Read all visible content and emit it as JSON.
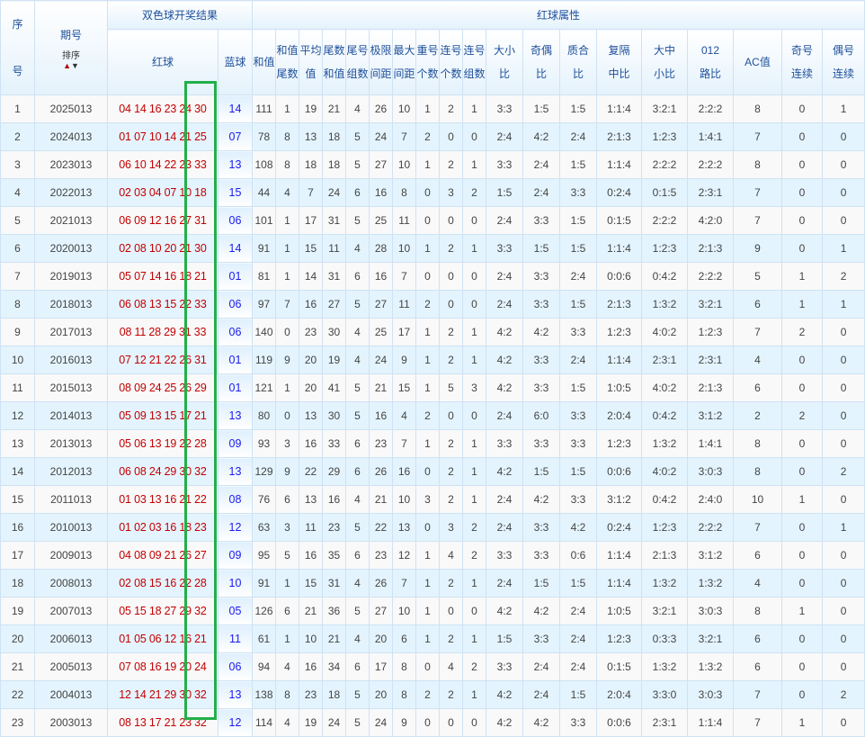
{
  "header": {
    "seq": "序号",
    "period": "期号",
    "sort_label": "排序",
    "sort_up": "▲",
    "sort_down": "▼",
    "result_group": "双色球开奖结果",
    "red_ball": "红球",
    "blue_ball": "蓝球",
    "attr_group": "红球属性",
    "attr_cols": [
      [
        "和值"
      ],
      [
        "和值",
        "尾数"
      ],
      [
        "平均",
        "值"
      ],
      [
        "尾数",
        "和值"
      ],
      [
        "尾号",
        "组数"
      ],
      [
        "极限",
        "间距"
      ],
      [
        "最大",
        "间距"
      ],
      [
        "重号",
        "个数"
      ],
      [
        "连号",
        "个数"
      ],
      [
        "连号",
        "组数"
      ],
      [
        "大小",
        "比"
      ],
      [
        "奇偶",
        "比"
      ],
      [
        "质合",
        "比"
      ],
      [
        "复隔",
        "中比"
      ],
      [
        "大中",
        "小比"
      ],
      [
        "012",
        "路比"
      ],
      [
        "AC值"
      ],
      [
        "奇号",
        "连续"
      ],
      [
        "偶号",
        "连续"
      ]
    ]
  },
  "colors": {
    "red_ball": "#c40000",
    "blue_ball": "#1a1aee",
    "highlight_box": "#22b04a",
    "header_text": "#1e4f9a"
  },
  "rows": [
    {
      "seq": "1",
      "period": "2025013",
      "red": "04 14 16 23 24 30",
      "blue": "14",
      "attrs": [
        "111",
        "1",
        "19",
        "21",
        "4",
        "26",
        "10",
        "1",
        "2",
        "1",
        "3:3",
        "1:5",
        "1:5",
        "1:1:4",
        "3:2:1",
        "2:2:2",
        "8",
        "0",
        "1"
      ]
    },
    {
      "seq": "2",
      "period": "2024013",
      "red": "01 07 10 14 21 25",
      "blue": "07",
      "attrs": [
        "78",
        "8",
        "13",
        "18",
        "5",
        "24",
        "7",
        "2",
        "0",
        "0",
        "2:4",
        "4:2",
        "2:4",
        "2:1:3",
        "1:2:3",
        "1:4:1",
        "7",
        "0",
        "0"
      ]
    },
    {
      "seq": "3",
      "period": "2023013",
      "red": "06 10 14 22 23 33",
      "blue": "13",
      "attrs": [
        "108",
        "8",
        "18",
        "18",
        "5",
        "27",
        "10",
        "1",
        "2",
        "1",
        "3:3",
        "2:4",
        "1:5",
        "1:1:4",
        "2:2:2",
        "2:2:2",
        "8",
        "0",
        "0"
      ]
    },
    {
      "seq": "4",
      "period": "2022013",
      "red": "02 03 04 07 10 18",
      "blue": "15",
      "attrs": [
        "44",
        "4",
        "7",
        "24",
        "6",
        "16",
        "8",
        "0",
        "3",
        "2",
        "1:5",
        "2:4",
        "3:3",
        "0:2:4",
        "0:1:5",
        "2:3:1",
        "7",
        "0",
        "0"
      ]
    },
    {
      "seq": "5",
      "period": "2021013",
      "red": "06 09 12 16 27 31",
      "blue": "06",
      "attrs": [
        "101",
        "1",
        "17",
        "31",
        "5",
        "25",
        "11",
        "0",
        "0",
        "0",
        "2:4",
        "3:3",
        "1:5",
        "0:1:5",
        "2:2:2",
        "4:2:0",
        "7",
        "0",
        "0"
      ]
    },
    {
      "seq": "6",
      "period": "2020013",
      "red": "02 08 10 20 21 30",
      "blue": "14",
      "attrs": [
        "91",
        "1",
        "15",
        "11",
        "4",
        "28",
        "10",
        "1",
        "2",
        "1",
        "3:3",
        "1:5",
        "1:5",
        "1:1:4",
        "1:2:3",
        "2:1:3",
        "9",
        "0",
        "1"
      ]
    },
    {
      "seq": "7",
      "period": "2019013",
      "red": "05 07 14 16 18 21",
      "blue": "01",
      "attrs": [
        "81",
        "1",
        "14",
        "31",
        "6",
        "16",
        "7",
        "0",
        "0",
        "0",
        "2:4",
        "3:3",
        "2:4",
        "0:0:6",
        "0:4:2",
        "2:2:2",
        "5",
        "1",
        "2"
      ]
    },
    {
      "seq": "8",
      "period": "2018013",
      "red": "06 08 13 15 22 33",
      "blue": "06",
      "attrs": [
        "97",
        "7",
        "16",
        "27",
        "5",
        "27",
        "11",
        "2",
        "0",
        "0",
        "2:4",
        "3:3",
        "1:5",
        "2:1:3",
        "1:3:2",
        "3:2:1",
        "6",
        "1",
        "1"
      ]
    },
    {
      "seq": "9",
      "period": "2017013",
      "red": "08 11 28 29 31 33",
      "blue": "06",
      "attrs": [
        "140",
        "0",
        "23",
        "30",
        "4",
        "25",
        "17",
        "1",
        "2",
        "1",
        "4:2",
        "4:2",
        "3:3",
        "1:2:3",
        "4:0:2",
        "1:2:3",
        "7",
        "2",
        "0"
      ]
    },
    {
      "seq": "10",
      "period": "2016013",
      "red": "07 12 21 22 26 31",
      "blue": "01",
      "attrs": [
        "119",
        "9",
        "20",
        "19",
        "4",
        "24",
        "9",
        "1",
        "2",
        "1",
        "4:2",
        "3:3",
        "2:4",
        "1:1:4",
        "2:3:1",
        "2:3:1",
        "4",
        "0",
        "0"
      ]
    },
    {
      "seq": "11",
      "period": "2015013",
      "red": "08 09 24 25 26 29",
      "blue": "01",
      "attrs": [
        "121",
        "1",
        "20",
        "41",
        "5",
        "21",
        "15",
        "1",
        "5",
        "3",
        "4:2",
        "3:3",
        "1:5",
        "1:0:5",
        "4:0:2",
        "2:1:3",
        "6",
        "0",
        "0"
      ]
    },
    {
      "seq": "12",
      "period": "2014013",
      "red": "05 09 13 15 17 21",
      "blue": "13",
      "attrs": [
        "80",
        "0",
        "13",
        "30",
        "5",
        "16",
        "4",
        "2",
        "0",
        "0",
        "2:4",
        "6:0",
        "3:3",
        "2:0:4",
        "0:4:2",
        "3:1:2",
        "2",
        "2",
        "0"
      ]
    },
    {
      "seq": "13",
      "period": "2013013",
      "red": "05 06 13 19 22 28",
      "blue": "09",
      "attrs": [
        "93",
        "3",
        "16",
        "33",
        "6",
        "23",
        "7",
        "1",
        "2",
        "1",
        "3:3",
        "3:3",
        "3:3",
        "1:2:3",
        "1:3:2",
        "1:4:1",
        "8",
        "0",
        "0"
      ]
    },
    {
      "seq": "14",
      "period": "2012013",
      "red": "06 08 24 29 30 32",
      "blue": "13",
      "attrs": [
        "129",
        "9",
        "22",
        "29",
        "6",
        "26",
        "16",
        "0",
        "2",
        "1",
        "4:2",
        "1:5",
        "1:5",
        "0:0:6",
        "4:0:2",
        "3:0:3",
        "8",
        "0",
        "2"
      ]
    },
    {
      "seq": "15",
      "period": "2011013",
      "red": "01 03 13 16 21 22",
      "blue": "08",
      "attrs": [
        "76",
        "6",
        "13",
        "16",
        "4",
        "21",
        "10",
        "3",
        "2",
        "1",
        "2:4",
        "4:2",
        "3:3",
        "3:1:2",
        "0:4:2",
        "2:4:0",
        "10",
        "1",
        "0"
      ]
    },
    {
      "seq": "16",
      "period": "2010013",
      "red": "01 02 03 16 18 23",
      "blue": "12",
      "attrs": [
        "63",
        "3",
        "11",
        "23",
        "5",
        "22",
        "13",
        "0",
        "3",
        "2",
        "2:4",
        "3:3",
        "4:2",
        "0:2:4",
        "1:2:3",
        "2:2:2",
        "7",
        "0",
        "1"
      ]
    },
    {
      "seq": "17",
      "period": "2009013",
      "red": "04 08 09 21 26 27",
      "blue": "09",
      "attrs": [
        "95",
        "5",
        "16",
        "35",
        "6",
        "23",
        "12",
        "1",
        "4",
        "2",
        "3:3",
        "3:3",
        "0:6",
        "1:1:4",
        "2:1:3",
        "3:1:2",
        "6",
        "0",
        "0"
      ]
    },
    {
      "seq": "18",
      "period": "2008013",
      "red": "02 08 15 16 22 28",
      "blue": "10",
      "attrs": [
        "91",
        "1",
        "15",
        "31",
        "4",
        "26",
        "7",
        "1",
        "2",
        "1",
        "2:4",
        "1:5",
        "1:5",
        "1:1:4",
        "1:3:2",
        "1:3:2",
        "4",
        "0",
        "0"
      ]
    },
    {
      "seq": "19",
      "period": "2007013",
      "red": "05 15 18 27 29 32",
      "blue": "05",
      "attrs": [
        "126",
        "6",
        "21",
        "36",
        "5",
        "27",
        "10",
        "1",
        "0",
        "0",
        "4:2",
        "4:2",
        "2:4",
        "1:0:5",
        "3:2:1",
        "3:0:3",
        "8",
        "1",
        "0"
      ]
    },
    {
      "seq": "20",
      "period": "2006013",
      "red": "01 05 06 12 16 21",
      "blue": "11",
      "attrs": [
        "61",
        "1",
        "10",
        "21",
        "4",
        "20",
        "6",
        "1",
        "2",
        "1",
        "1:5",
        "3:3",
        "2:4",
        "1:2:3",
        "0:3:3",
        "3:2:1",
        "6",
        "0",
        "0"
      ]
    },
    {
      "seq": "21",
      "period": "2005013",
      "red": "07 08 16 19 20 24",
      "blue": "06",
      "attrs": [
        "94",
        "4",
        "16",
        "34",
        "6",
        "17",
        "8",
        "0",
        "4",
        "2",
        "3:3",
        "2:4",
        "2:4",
        "0:1:5",
        "1:3:2",
        "1:3:2",
        "6",
        "0",
        "0"
      ]
    },
    {
      "seq": "22",
      "period": "2004013",
      "red": "12 14 21 29 30 32",
      "blue": "13",
      "attrs": [
        "138",
        "8",
        "23",
        "18",
        "5",
        "20",
        "8",
        "2",
        "2",
        "1",
        "4:2",
        "2:4",
        "1:5",
        "2:0:4",
        "3:3:0",
        "3:0:3",
        "7",
        "0",
        "2"
      ]
    },
    {
      "seq": "23",
      "period": "2003013",
      "red": "08 13 17 21 23 32",
      "blue": "12",
      "attrs": [
        "114",
        "4",
        "19",
        "24",
        "5",
        "24",
        "9",
        "0",
        "0",
        "0",
        "4:2",
        "4:2",
        "3:3",
        "0:0:6",
        "2:3:1",
        "1:1:4",
        "7",
        "1",
        "0"
      ]
    }
  ]
}
